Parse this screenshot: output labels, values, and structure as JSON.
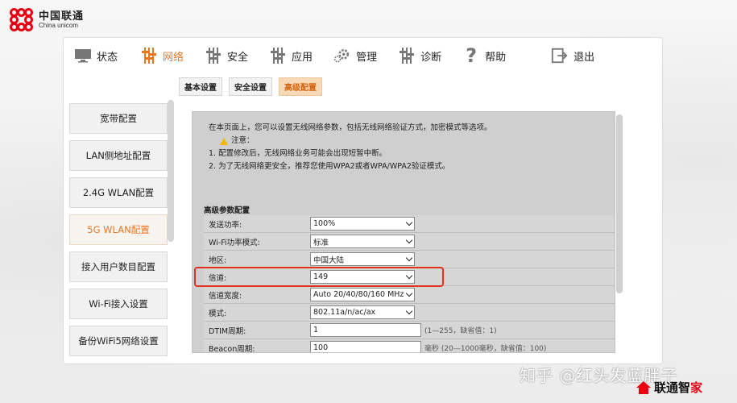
{
  "brand": {
    "cn": "中国联通",
    "en": "China unicom"
  },
  "nav": [
    {
      "label": "状态",
      "icon": "monitor-icon",
      "active": false
    },
    {
      "label": "网络",
      "icon": "network-bars-icon",
      "active": true
    },
    {
      "label": "安全",
      "icon": "security-bars-icon",
      "active": false
    },
    {
      "label": "应用",
      "icon": "apps-bars-icon",
      "active": false
    },
    {
      "label": "管理",
      "icon": "gear-icon",
      "active": false
    },
    {
      "label": "诊断",
      "icon": "diagnose-bars-icon",
      "active": false
    },
    {
      "label": "帮助",
      "icon": "question-icon",
      "active": false
    },
    {
      "label": "退出",
      "icon": "logout-icon",
      "active": false
    }
  ],
  "subtabs": [
    {
      "label": "基本设置",
      "active": false
    },
    {
      "label": "安全设置",
      "active": false
    },
    {
      "label": "高级配置",
      "active": true
    }
  ],
  "sidebar": [
    {
      "label": "宽带配置",
      "active": false
    },
    {
      "label": "LAN侧地址配置",
      "active": false
    },
    {
      "label": "2.4G WLAN配置",
      "active": false
    },
    {
      "label": "5G WLAN配置",
      "active": true
    },
    {
      "label": "接入用户数目配置",
      "active": false
    },
    {
      "label": "Wi-Fi接入设置",
      "active": false
    },
    {
      "label": "备份WiFi5网络设置",
      "active": false
    }
  ],
  "intro": {
    "line1": "在本页面上，您可以设置无线网络参数，包括无线网络验证方式，加密模式等选项。",
    "note_label": "注意：",
    "note1": "1. 配置修改后，无线网络业务可能会出现短暂中断。",
    "note2": "2. 为了无线网络更安全，推荐您使用WPA2或者WPA/WPA2验证模式。"
  },
  "section_title": "高级参数配置",
  "form": [
    {
      "label": "发送功率:",
      "type": "select",
      "value": "100%"
    },
    {
      "label": "Wi-Fi功率模式:",
      "type": "select",
      "value": "标准"
    },
    {
      "label": "地区:",
      "type": "select",
      "value": "中国大陆"
    },
    {
      "label": "信道:",
      "type": "select",
      "value": "149"
    },
    {
      "label": "信道宽度:",
      "type": "select",
      "value": "Auto 20/40/80/160 MHz"
    },
    {
      "label": "模式:",
      "type": "select",
      "value": "802.11a/n/ac/ax"
    },
    {
      "label": "DTIM周期:",
      "type": "text",
      "value": "1",
      "hint": "(1—255，缺省值：1)"
    },
    {
      "label": "Beacon周期:",
      "type": "text",
      "value": "100",
      "hint": "毫秒 (20—1000毫秒，缺省值：100)"
    }
  ],
  "watermark": "知乎 @红头发蓝胖子",
  "footer_brand": {
    "a": "联通智",
    "b": "家"
  },
  "colors": {
    "accent": "#e87722",
    "highlight": "#e0321e",
    "brand_red": "#e60012"
  }
}
